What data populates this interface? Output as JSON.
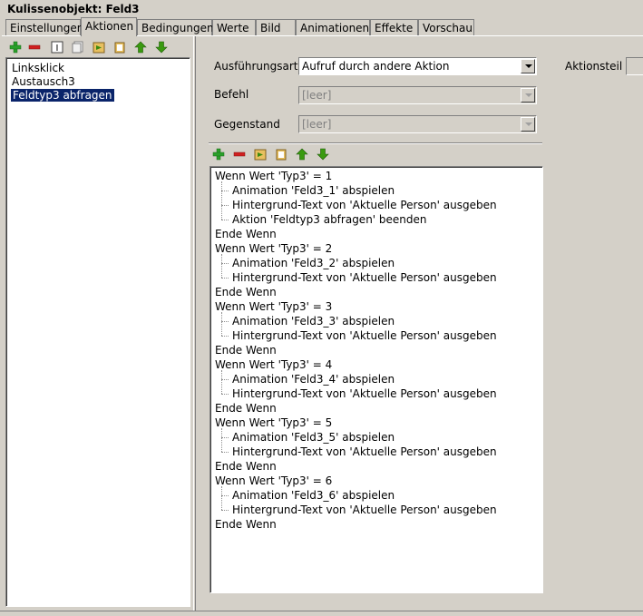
{
  "window": {
    "title": "Kulissenobjekt: Feld3"
  },
  "tabs": [
    "Einstellungen",
    "Aktionen",
    "Bedingungen",
    "Werte",
    "Bild",
    "Animationen",
    "Effekte",
    "Vorschau"
  ],
  "active_tab": "Aktionen",
  "action_list": {
    "items": [
      "Linksklick",
      "Austausch3",
      "Feldtyp3 abfragen"
    ],
    "selected": "Feldtyp3 abfragen"
  },
  "left_toolbar_icons": [
    "plus-icon",
    "minus-icon",
    "rename-icon",
    "copy-icon",
    "paste-icon",
    "clipboard-icon",
    "move-up-icon",
    "move-down-icon"
  ],
  "form": {
    "execution_label": "Ausführungsart",
    "execution_value": "Aufruf durch andere Aktion",
    "command_label": "Befehl",
    "command_value": "[leer]",
    "object_label": "Gegenstand",
    "object_value": "[leer]",
    "action_part_label": "Aktionsteil"
  },
  "steps_toolbar_icons": [
    "plus-icon",
    "minus-icon",
    "paste-icon",
    "clipboard-icon",
    "move-up-icon",
    "move-down-icon"
  ],
  "steps": [
    {
      "level": 0,
      "text": "Wenn Wert 'Typ3' = 1"
    },
    {
      "level": 1,
      "text": "Animation 'Feld3_1' abspielen"
    },
    {
      "level": 1,
      "text": "Hintergrund-Text von 'Aktuelle Person' ausgeben"
    },
    {
      "level": 1,
      "text": "Aktion 'Feldtyp3 abfragen' beenden"
    },
    {
      "level": 0,
      "text": "Ende Wenn"
    },
    {
      "level": 0,
      "text": "Wenn Wert 'Typ3' = 2"
    },
    {
      "level": 1,
      "text": "Animation 'Feld3_2' abspielen"
    },
    {
      "level": 1,
      "text": "Hintergrund-Text von 'Aktuelle Person' ausgeben"
    },
    {
      "level": 0,
      "text": "Ende Wenn"
    },
    {
      "level": 0,
      "text": "Wenn Wert 'Typ3' = 3"
    },
    {
      "level": 1,
      "text": "Animation 'Feld3_3' abspielen"
    },
    {
      "level": 1,
      "text": "Hintergrund-Text von 'Aktuelle Person' ausgeben"
    },
    {
      "level": 0,
      "text": "Ende Wenn"
    },
    {
      "level": 0,
      "text": "Wenn Wert 'Typ3' = 4"
    },
    {
      "level": 1,
      "text": "Animation 'Feld3_4' abspielen"
    },
    {
      "level": 1,
      "text": "Hintergrund-Text von 'Aktuelle Person' ausgeben"
    },
    {
      "level": 0,
      "text": "Ende Wenn"
    },
    {
      "level": 0,
      "text": "Wenn Wert 'Typ3' = 5"
    },
    {
      "level": 1,
      "text": "Animation 'Feld3_5' abspielen"
    },
    {
      "level": 1,
      "text": "Hintergrund-Text von 'Aktuelle Person' ausgeben"
    },
    {
      "level": 0,
      "text": "Ende Wenn"
    },
    {
      "level": 0,
      "text": "Wenn Wert 'Typ3' = 6"
    },
    {
      "level": 1,
      "text": "Animation 'Feld3_6' abspielen"
    },
    {
      "level": 1,
      "text": "Hintergrund-Text von 'Aktuelle Person' ausgeben"
    },
    {
      "level": 0,
      "text": "Ende Wenn"
    }
  ],
  "colors": {
    "selection": "#0a246a",
    "add_green": "#2aa02a",
    "remove_red": "#d02020",
    "arrow_green": "#3a9a10"
  }
}
